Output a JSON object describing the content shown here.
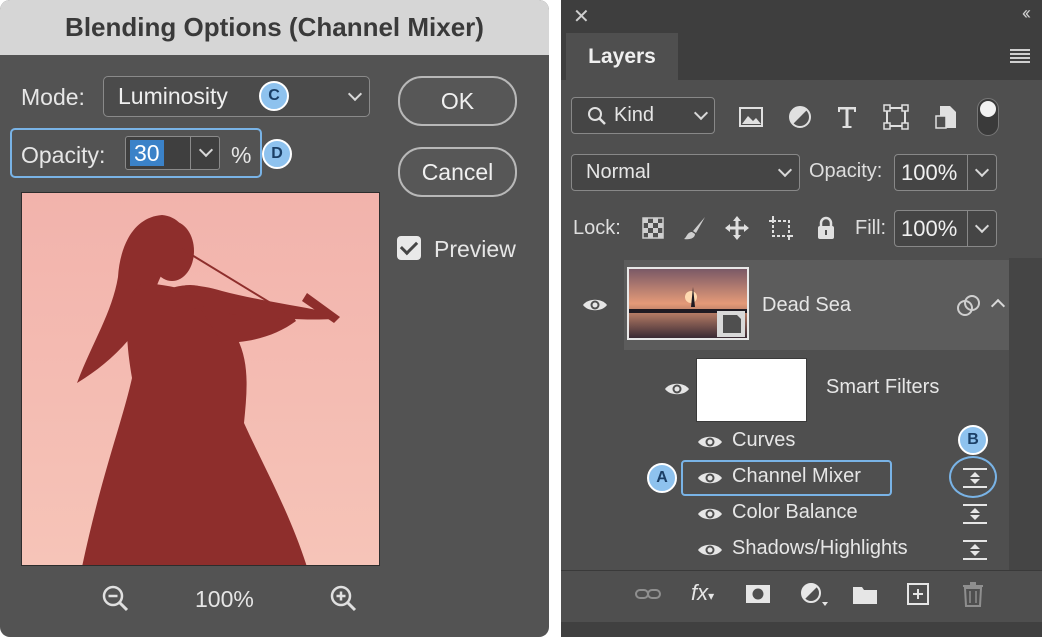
{
  "dialog": {
    "title": "Blending Options (Channel Mixer)",
    "mode_label": "Mode:",
    "mode_value": "Luminosity",
    "opacity_label": "Opacity:",
    "opacity_value": "30",
    "opacity_unit": "%",
    "ok_label": "OK",
    "cancel_label": "Cancel",
    "preview_label": "Preview",
    "preview_checked": true,
    "zoom_level": "100%",
    "callout_c": "C",
    "callout_d": "D"
  },
  "layers_panel": {
    "tab_label": "Layers",
    "filter_kind": "Kind",
    "blend_mode": "Normal",
    "opacity_label": "Opacity:",
    "opacity_value": "100%",
    "lock_label": "Lock:",
    "fill_label": "Fill:",
    "fill_value": "100%",
    "layer_name": "Dead Sea",
    "smart_filters_label": "Smart Filters",
    "filters": [
      {
        "name": "Curves"
      },
      {
        "name": "Channel Mixer"
      },
      {
        "name": "Color Balance"
      },
      {
        "name": "Shadows/Highlights"
      }
    ],
    "callout_a": "A",
    "callout_b": "B"
  },
  "colors": {
    "accent_blue": "#79b3e6",
    "badge_fill": "#8ec2ee",
    "dialog_bg": "#535353",
    "panel_bg": "#4f4f4f"
  },
  "icons": [
    "search-icon",
    "image-filter-icon",
    "adjustment-filter-icon",
    "type-filter-icon",
    "shape-filter-icon",
    "smart-object-filter-icon",
    "eye-icon",
    "filter-blending-options-icon",
    "link-icon",
    "fx-icon",
    "mask-icon",
    "new-adjustment-icon",
    "folder-icon",
    "new-layer-icon",
    "trash-icon",
    "zoom-out-icon",
    "zoom-in-icon",
    "checkerboard-lock-icon",
    "brush-lock-icon",
    "move-lock-icon",
    "artboard-lock-icon",
    "padlock-icon"
  ]
}
